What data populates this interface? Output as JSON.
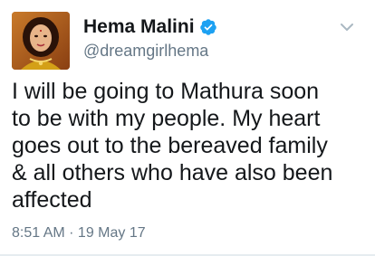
{
  "tweet": {
    "author": {
      "display_name": "Hema Malini",
      "handle": "@dreamgirlhema",
      "verified": true,
      "avatar_icon": "profile-photo"
    },
    "text": "I will be going to Mathura soon\nto be with my people. My heart\ngoes out to the bereaved family\n& all others who have also been\naffected",
    "timestamp": "8:51 AM · 19 May 17"
  },
  "colors": {
    "primary_text": "#14171a",
    "secondary_text": "#657786",
    "verified_badge": "#1da1f2",
    "background": "#ffffff"
  },
  "icons": {
    "verified": "verified-badge-icon",
    "menu": "chevron-down-icon"
  }
}
